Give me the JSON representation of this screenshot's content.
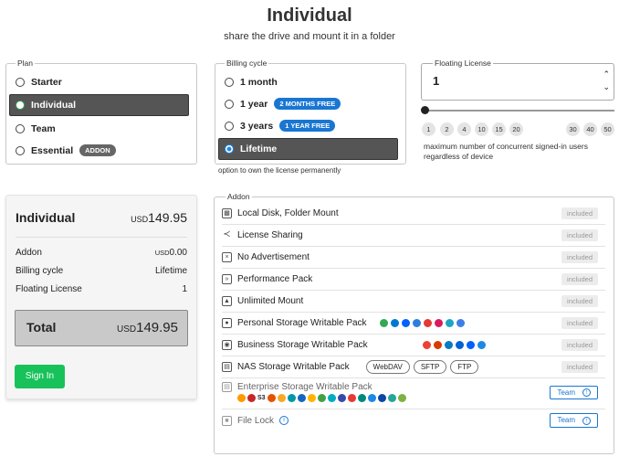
{
  "header": {
    "title": "Individual",
    "subtitle": "share the drive and mount it in a folder"
  },
  "plan": {
    "legend": "Plan",
    "options": [
      {
        "label": "Starter",
        "selected": false
      },
      {
        "label": "Individual",
        "selected": true
      },
      {
        "label": "Team",
        "selected": false
      },
      {
        "label": "Essential",
        "selected": false,
        "badge": "ADDON"
      }
    ]
  },
  "billing": {
    "legend": "Billing cycle",
    "options": [
      {
        "label": "1 month",
        "selected": false
      },
      {
        "label": "1 year",
        "selected": false,
        "badge": "2 MONTHS FREE"
      },
      {
        "label": "3 years",
        "selected": false,
        "badge": "1 YEAR FREE"
      },
      {
        "label": "Lifetime",
        "selected": true
      }
    ],
    "note": "option to own the license permanently"
  },
  "floating": {
    "legend": "Floating License",
    "value": "1",
    "ticks": [
      "1",
      "2",
      "4",
      "10",
      "15",
      "20",
      "30",
      "40",
      "50"
    ],
    "description": "maximum number of concurrent signed-in users regardless of device",
    "slider_fraction": 0.0
  },
  "summary": {
    "title": "Individual",
    "price_currency": "USD",
    "price_amount": "149.95",
    "rows": [
      {
        "label": "Addon",
        "currency": "USD",
        "value": "0.00"
      },
      {
        "label": "Billing cycle",
        "currency": "",
        "value": "Lifetime"
      },
      {
        "label": "Floating License",
        "currency": "",
        "value": "1"
      }
    ],
    "total_label": "Total",
    "total_currency": "USD",
    "total_amount": "149.95",
    "signin_label": "Sign In"
  },
  "addon": {
    "legend": "Addon",
    "included_label": "included",
    "items": [
      {
        "label": "Local Disk, Folder Mount",
        "icon": "disk-icon"
      },
      {
        "label": "License Sharing",
        "icon": "share-icon"
      },
      {
        "label": "No Advertisement",
        "icon": "no-ads-icon"
      },
      {
        "label": "Performance Pack",
        "icon": "speed-icon"
      },
      {
        "label": "Unlimited Mount",
        "icon": "mount-icon"
      },
      {
        "label": "Personal Storage Writable Pack",
        "icon": "person-icon"
      },
      {
        "label": "Business Storage Writable Pack",
        "icon": "group-icon"
      },
      {
        "label": "NAS Storage Writable Pack",
        "icon": "nas-icon"
      }
    ],
    "nas_chips": [
      "WebDAV",
      "SFTP",
      "FTP"
    ],
    "enterprise_label": "Enterprise Storage Writable Pack",
    "enterprise_brand_text": "S3",
    "file_lock_label": "File Lock",
    "team_label": "Team",
    "colors": {
      "accent": "#1976d2",
      "signin": "#18c25a",
      "selected_bg": "#555555"
    }
  }
}
